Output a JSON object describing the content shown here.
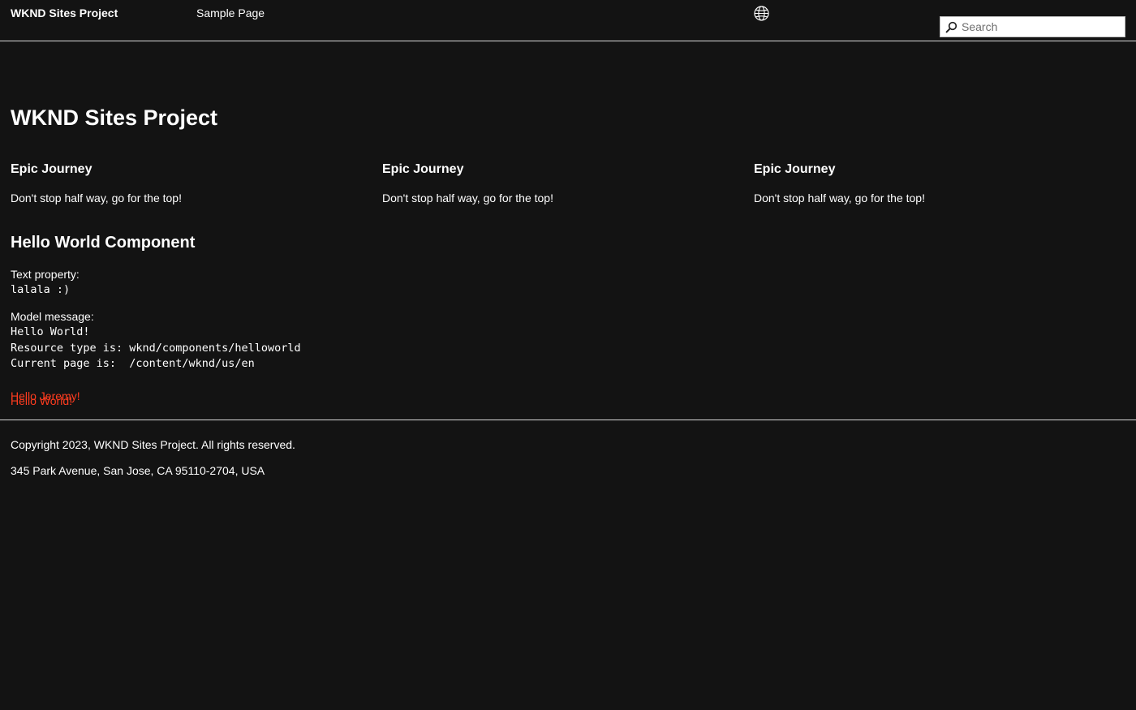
{
  "header": {
    "brand": "WKND Sites Project",
    "nav_items": [
      {
        "label": "Sample Page"
      }
    ],
    "language_icon": "globe-icon",
    "search": {
      "placeholder": "Search",
      "value": "",
      "icon": "search-icon"
    }
  },
  "main": {
    "title": "WKND Sites Project",
    "teasers": [
      {
        "title": "Epic Journey",
        "description": "Don't stop half way, go for the top!"
      },
      {
        "title": "Epic Journey",
        "description": "Don't stop half way, go for the top!"
      },
      {
        "title": "Epic Journey",
        "description": "Don't stop half way, go for the top!"
      }
    ],
    "hello_world": {
      "title": "Hello World Component",
      "text_property_label": "Text property:",
      "text_property_value": "lalala :)",
      "model_message_label": "Model message:",
      "model_lines": [
        "Hello World!",
        "Resource type is: wknd/components/helloworld",
        "Current page is:  /content/wknd/us/en"
      ]
    },
    "red_lines": [
      "Hello World!",
      "Hello Jeremy!"
    ]
  },
  "footer": {
    "copyright": "Copyright 2023, WKND Sites Project. All rights reserved.",
    "address": "345 Park Avenue, San Jose, CA 95110-2704, USA"
  },
  "colors": {
    "background": "#131313",
    "text": "#ffffff",
    "accent_red": "#ff3c1f",
    "divider": "#d8d8d8"
  }
}
